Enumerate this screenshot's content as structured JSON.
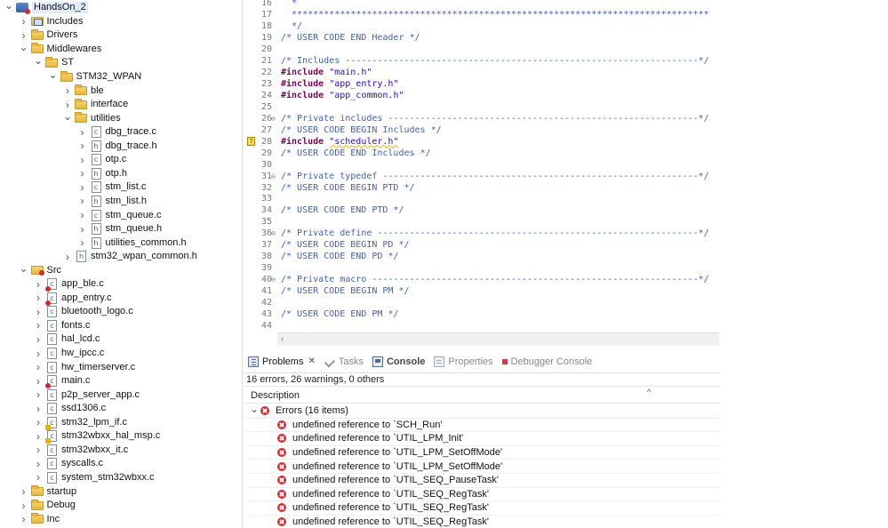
{
  "explorer": {
    "items": [
      {
        "label": "HandsOn_2",
        "depth": 0,
        "arrow": "down",
        "icon": "project",
        "selected": true
      },
      {
        "label": "Includes",
        "depth": 1,
        "arrow": "right",
        "icon": "lib"
      },
      {
        "label": "Drivers",
        "depth": 1,
        "arrow": "right",
        "icon": "folder"
      },
      {
        "label": "Middlewares",
        "depth": 1,
        "arrow": "down",
        "icon": "folder"
      },
      {
        "label": "ST",
        "depth": 2,
        "arrow": "down",
        "icon": "folder"
      },
      {
        "label": "STM32_WPAN",
        "depth": 3,
        "arrow": "down",
        "icon": "folder"
      },
      {
        "label": "ble",
        "depth": 4,
        "arrow": "right",
        "icon": "folder"
      },
      {
        "label": "interface",
        "depth": 4,
        "arrow": "right",
        "icon": "folder"
      },
      {
        "label": "utilities",
        "depth": 4,
        "arrow": "down",
        "icon": "folder"
      },
      {
        "label": "dbg_trace.c",
        "depth": 5,
        "arrow": "right",
        "icon": "c"
      },
      {
        "label": "dbg_trace.h",
        "depth": 5,
        "arrow": "right",
        "icon": "h"
      },
      {
        "label": "otp.c",
        "depth": 5,
        "arrow": "right",
        "icon": "c"
      },
      {
        "label": "otp.h",
        "depth": 5,
        "arrow": "right",
        "icon": "h"
      },
      {
        "label": "stm_list.c",
        "depth": 5,
        "arrow": "right",
        "icon": "c"
      },
      {
        "label": "stm_list.h",
        "depth": 5,
        "arrow": "right",
        "icon": "h"
      },
      {
        "label": "stm_queue.c",
        "depth": 5,
        "arrow": "right",
        "icon": "c"
      },
      {
        "label": "stm_queue.h",
        "depth": 5,
        "arrow": "right",
        "icon": "h"
      },
      {
        "label": "utilities_common.h",
        "depth": 5,
        "arrow": "right",
        "icon": "h"
      },
      {
        "label": "stm32_wpan_common.h",
        "depth": 4,
        "arrow": "right",
        "icon": "h"
      },
      {
        "label": "Src",
        "depth": 1,
        "arrow": "down",
        "icon": "srcfolder"
      },
      {
        "label": "app_ble.c",
        "depth": 2,
        "arrow": "right",
        "icon": "c-err"
      },
      {
        "label": "app_entry.c",
        "depth": 2,
        "arrow": "right",
        "icon": "c-err"
      },
      {
        "label": "bluetooth_logo.c",
        "depth": 2,
        "arrow": "right",
        "icon": "c"
      },
      {
        "label": "fonts.c",
        "depth": 2,
        "arrow": "right",
        "icon": "c"
      },
      {
        "label": "hal_lcd.c",
        "depth": 2,
        "arrow": "right",
        "icon": "c"
      },
      {
        "label": "hw_ipcc.c",
        "depth": 2,
        "arrow": "right",
        "icon": "c"
      },
      {
        "label": "hw_timerserver.c",
        "depth": 2,
        "arrow": "right",
        "icon": "c"
      },
      {
        "label": "main.c",
        "depth": 2,
        "arrow": "right",
        "icon": "c-err"
      },
      {
        "label": "p2p_server_app.c",
        "depth": 2,
        "arrow": "right",
        "icon": "c"
      },
      {
        "label": "ssd1306.c",
        "depth": 2,
        "arrow": "right",
        "icon": "c"
      },
      {
        "label": "stm32_lpm_if.c",
        "depth": 2,
        "arrow": "right",
        "icon": "c-warn"
      },
      {
        "label": "stm32wbxx_hal_msp.c",
        "depth": 2,
        "arrow": "right",
        "icon": "c-warn"
      },
      {
        "label": "stm32wbxx_it.c",
        "depth": 2,
        "arrow": "right",
        "icon": "c"
      },
      {
        "label": "syscalls.c",
        "depth": 2,
        "arrow": "right",
        "icon": "c"
      },
      {
        "label": "system_stm32wbxx.c",
        "depth": 2,
        "arrow": "right",
        "icon": "c"
      },
      {
        "label": "startup",
        "depth": 1,
        "arrow": "right",
        "icon": "folder"
      },
      {
        "label": "Debug",
        "depth": 1,
        "arrow": "right",
        "icon": "folder"
      },
      {
        "label": "Inc",
        "depth": 1,
        "arrow": "right",
        "icon": "folder"
      }
    ]
  },
  "editor": {
    "lines": [
      {
        "n": "16",
        "fold": "",
        "marker": "",
        "parts": [
          {
            "t": "  *",
            "c": "comment"
          }
        ]
      },
      {
        "n": "17",
        "fold": "",
        "marker": "",
        "parts": [
          {
            "t": "  ******************************************************************************",
            "c": "comment"
          }
        ]
      },
      {
        "n": "18",
        "fold": "",
        "marker": "",
        "parts": [
          {
            "t": "  */",
            "c": "comment"
          }
        ]
      },
      {
        "n": "19",
        "fold": "",
        "marker": "",
        "parts": [
          {
            "t": "/* USER CODE END Header */",
            "c": "comment"
          }
        ]
      },
      {
        "n": "20",
        "fold": "",
        "marker": "",
        "parts": []
      },
      {
        "n": "21",
        "fold": "",
        "marker": "",
        "parts": [
          {
            "t": "/* Includes ------------------------------------------------------------------*/",
            "c": "comment"
          }
        ]
      },
      {
        "n": "22",
        "fold": "",
        "marker": "",
        "parts": [
          {
            "t": "#include",
            "c": "keyword"
          },
          {
            "t": " ",
            "c": ""
          },
          {
            "t": "\"main.h\"",
            "c": "string"
          }
        ]
      },
      {
        "n": "23",
        "fold": "",
        "marker": "",
        "parts": [
          {
            "t": "#include",
            "c": "keyword"
          },
          {
            "t": " ",
            "c": ""
          },
          {
            "t": "\"app_entry.h\"",
            "c": "string"
          }
        ]
      },
      {
        "n": "24",
        "fold": "",
        "marker": "",
        "parts": [
          {
            "t": "#include",
            "c": "keyword"
          },
          {
            "t": " ",
            "c": ""
          },
          {
            "t": "\"app_common.h\"",
            "c": "string"
          }
        ]
      },
      {
        "n": "25",
        "fold": "",
        "marker": "",
        "parts": []
      },
      {
        "n": "26",
        "fold": "⊖",
        "marker": "",
        "parts": [
          {
            "t": "/* Private includes ----------------------------------------------------------*/",
            "c": "comment"
          }
        ]
      },
      {
        "n": "27",
        "fold": "",
        "marker": "",
        "parts": [
          {
            "t": "/* USER CODE BEGIN Includes */",
            "c": "comment"
          }
        ]
      },
      {
        "n": "28",
        "fold": "",
        "marker": "?",
        "parts": [
          {
            "t": "#include",
            "c": "keyword"
          },
          {
            "t": " ",
            "c": ""
          },
          {
            "t": "\"scheduler.h\"",
            "c": "string squiggle"
          }
        ]
      },
      {
        "n": "29",
        "fold": "",
        "marker": "",
        "parts": [
          {
            "t": "/* USER CODE END Includes */",
            "c": "comment"
          }
        ]
      },
      {
        "n": "30",
        "fold": "",
        "marker": "",
        "parts": []
      },
      {
        "n": "31",
        "fold": "⊖",
        "marker": "",
        "parts": [
          {
            "t": "/* Private typedef -----------------------------------------------------------*/",
            "c": "comment"
          }
        ]
      },
      {
        "n": "32",
        "fold": "",
        "marker": "",
        "parts": [
          {
            "t": "/* USER CODE BEGIN PTD */",
            "c": "comment"
          }
        ]
      },
      {
        "n": "33",
        "fold": "",
        "marker": "",
        "parts": []
      },
      {
        "n": "34",
        "fold": "",
        "marker": "",
        "parts": [
          {
            "t": "/* USER CODE END PTD */",
            "c": "comment"
          }
        ]
      },
      {
        "n": "35",
        "fold": "",
        "marker": "",
        "parts": []
      },
      {
        "n": "36",
        "fold": "⊖",
        "marker": "",
        "parts": [
          {
            "t": "/* Private define ------------------------------------------------------------*/",
            "c": "comment"
          }
        ]
      },
      {
        "n": "37",
        "fold": "",
        "marker": "",
        "parts": [
          {
            "t": "/* USER CODE BEGIN PD */",
            "c": "comment"
          }
        ]
      },
      {
        "n": "38",
        "fold": "",
        "marker": "",
        "parts": [
          {
            "t": "/* USER CODE END PD */",
            "c": "comment"
          }
        ]
      },
      {
        "n": "39",
        "fold": "",
        "marker": "",
        "parts": []
      },
      {
        "n": "40",
        "fold": "⊖",
        "marker": "",
        "parts": [
          {
            "t": "/* Private macro -------------------------------------------------------------*/",
            "c": "comment"
          }
        ]
      },
      {
        "n": "41",
        "fold": "",
        "marker": "",
        "parts": [
          {
            "t": "/* USER CODE BEGIN PM */",
            "c": "comment"
          }
        ]
      },
      {
        "n": "42",
        "fold": "",
        "marker": "",
        "parts": []
      },
      {
        "n": "43",
        "fold": "",
        "marker": "",
        "parts": [
          {
            "t": "/* USER CODE END PM */",
            "c": "comment"
          }
        ]
      },
      {
        "n": "44",
        "fold": "",
        "marker": "",
        "parts": []
      }
    ]
  },
  "problems": {
    "tabs": [
      {
        "label": "Problems",
        "icon": "problems-icon",
        "state": "active",
        "closable": true
      },
      {
        "label": "Tasks",
        "icon": "tasks-icon",
        "state": "inactive"
      },
      {
        "label": "Console",
        "icon": "console-icon",
        "state": "bold"
      },
      {
        "label": "Properties",
        "icon": "properties-icon",
        "state": "inactive"
      },
      {
        "label": "Debugger Console",
        "icon": "debugger-console-icon",
        "state": "inactive"
      }
    ],
    "close_glyph": "✕",
    "summary": "16 errors, 26 warnings, 0 others",
    "column_header": "Description",
    "group_label": "Errors (16 items)",
    "items": [
      "undefined reference to `SCH_Run'",
      "undefined reference to `UTIL_LPM_Init'",
      "undefined reference to `UTIL_LPM_SetOffMode'",
      "undefined reference to `UTIL_LPM_SetOffMode'",
      "undefined reference to `UTIL_SEQ_PauseTask'",
      "undefined reference to `UTIL_SEQ_RegTask'",
      "undefined reference to `UTIL_SEQ_RegTask'",
      "undefined reference to `UTIL_SEQ_RegTask'"
    ]
  },
  "colors": {
    "comment": "#3f5fbf",
    "keyword": "#7f0055",
    "string": "#2a00ff",
    "error": "#e0262e",
    "selection": "#e1ecf8"
  }
}
